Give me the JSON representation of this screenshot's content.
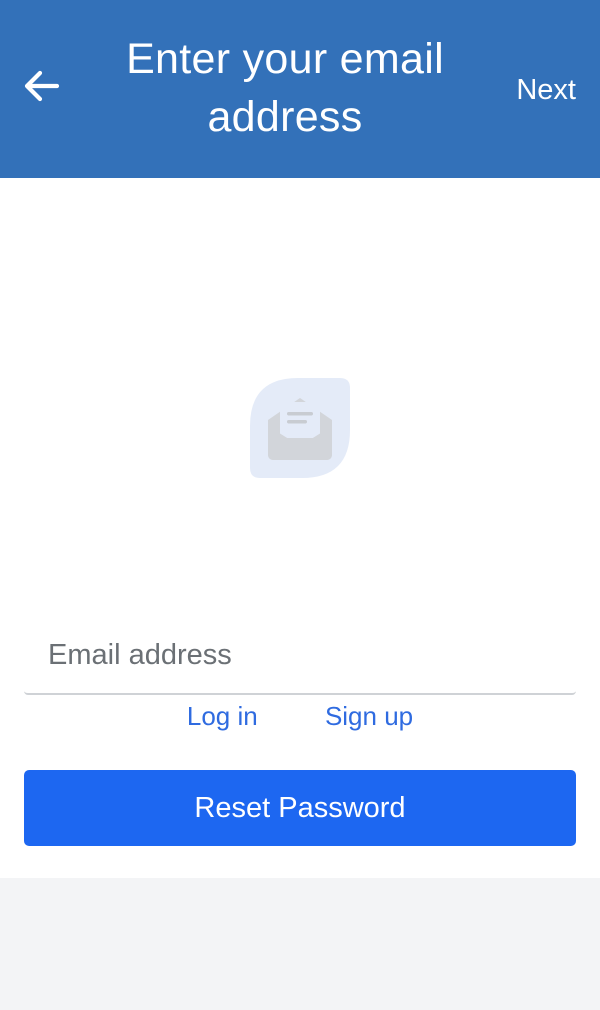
{
  "header": {
    "title": "Enter your email address",
    "back_icon": "arrow-left-icon",
    "next_label": "Next",
    "background_color": "#3371b9"
  },
  "illustration": {
    "icon": "open-envelope-icon"
  },
  "form": {
    "email_value": "",
    "email_placeholder": "Email address",
    "login_link": "Log in",
    "signup_link": "Sign up",
    "reset_button": "Reset Password",
    "button_color": "#1d67f1",
    "link_color": "#2f6be0"
  }
}
